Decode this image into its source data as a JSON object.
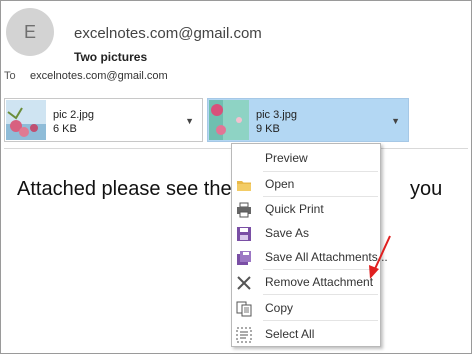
{
  "header": {
    "avatar_letter": "E",
    "from": "excelnotes.com@gmail.com",
    "subject": "Two pictures",
    "to_label": "To",
    "to_value": "excelnotes.com@gmail.com"
  },
  "attachments": [
    {
      "name": "pic 2.jpg",
      "size": "6 KB"
    },
    {
      "name": "pic 3.jpg",
      "size": "9 KB"
    }
  ],
  "body": {
    "text_before_menu": "Attached please see the",
    "text_after_menu": "you"
  },
  "context_menu": {
    "items": [
      {
        "label": "Preview",
        "icon": "none"
      },
      {
        "label": "Open",
        "icon": "folder-icon"
      },
      {
        "label": "Quick Print",
        "icon": "printer-icon"
      },
      {
        "label": "Save As",
        "icon": "save-as-icon"
      },
      {
        "label": "Save All Attachments...",
        "icon": "save-all-icon"
      },
      {
        "label": "Remove Attachment",
        "icon": "close-icon"
      },
      {
        "label": "Copy",
        "icon": "copy-icon"
      },
      {
        "label": "Select All",
        "icon": "select-all-icon"
      }
    ]
  },
  "colors": {
    "selected_attachment": "#b3d7f3",
    "annotation_arrow": "#e02020"
  }
}
